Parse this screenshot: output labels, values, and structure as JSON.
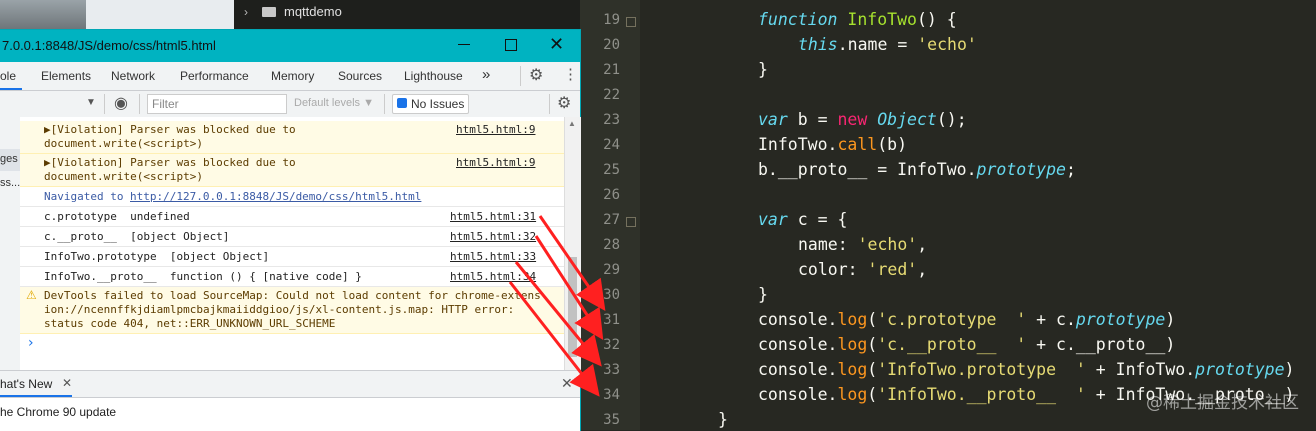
{
  "file_tree": {
    "folder_label": "mqttdemo"
  },
  "window": {
    "title": "7.0.0.1:8848/JS/demo/css/html5.html"
  },
  "devtools": {
    "tabs": [
      "ole",
      "Elements",
      "Network",
      "Performance",
      "Memory",
      "Sources",
      "Lighthouse"
    ],
    "more": "»",
    "filter_placeholder": "Filter",
    "levels_label": "Default levels ▼",
    "issues_label": "No Issues",
    "sidebar": [
      "ges",
      "ss..."
    ],
    "console": {
      "violation_1": "▶[Violation] Parser was blocked due to\ndocument.write(<script>)",
      "violation_1_src": "html5.html:9",
      "violation_2": "▶[Violation] Parser was blocked due to\ndocument.write(<script>)",
      "violation_2_src": "html5.html:9",
      "navigated_prefix": "Navigated to ",
      "navigated_url": "http://127.0.0.1:8848/JS/demo/css/html5.html",
      "log_1": "c.prototype  undefined",
      "log_1_src": "html5.html:31",
      "log_2": "c.__proto__  [object Object]",
      "log_2_src": "html5.html:32",
      "log_3": "InfoTwo.prototype  [object Object]",
      "log_3_src": "html5.html:33",
      "log_4": "InfoTwo.__proto__  function () { [native code] }",
      "log_4_src": "html5.html:34",
      "devtools_warning": "DevTools failed to load SourceMap: Could not load content for chrome-extens\nion://ncennffkjdiamlpmcbajkmaiiddgioo/js/xl-content.js.map: HTTP error:\nstatus code 404, net::ERR_UNKNOWN_URL_SCHEME",
      "prompt": "›"
    },
    "drawer": {
      "tab": "hat's New",
      "text": "he Chrome 90 update"
    }
  },
  "editor": {
    "line_numbers": [
      "19",
      "20",
      "21",
      "22",
      "23",
      "24",
      "25",
      "26",
      "27",
      "28",
      "29",
      "30",
      "31",
      "32",
      "33",
      "34",
      "35"
    ]
  },
  "watermark": "@稀土掘金技术社区",
  "colors": {
    "editor_bg": "#272822",
    "titlebar": "#00b3c1",
    "arrow": "#ff2020"
  }
}
